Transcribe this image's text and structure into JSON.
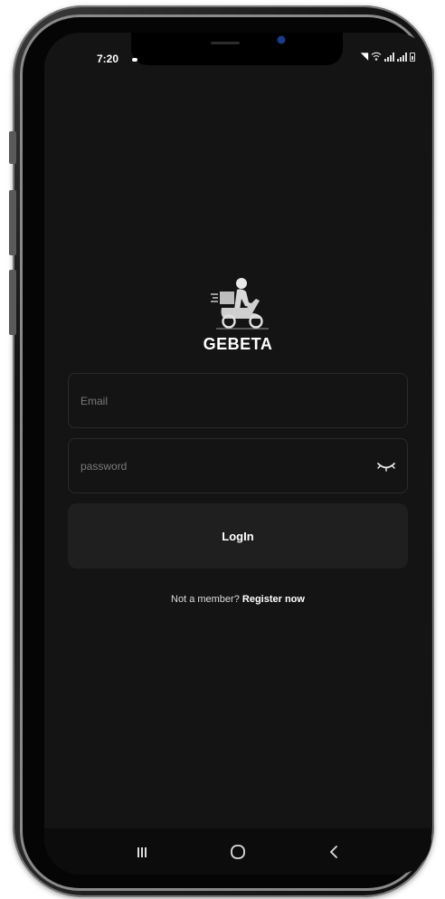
{
  "status_bar": {
    "time": "7:20",
    "icons": [
      "mute-icon",
      "wifi-icon",
      "signal-icon",
      "signal-icon",
      "battery-icon"
    ]
  },
  "logo": {
    "name": "GEBETA",
    "icon": "scooter-courier-logo-icon"
  },
  "login_form": {
    "email_placeholder": "Email",
    "email_value": "",
    "password_placeholder": "password",
    "password_value": "",
    "toggle_icon": "eye-closed-icon",
    "login_label": "LogIn"
  },
  "register": {
    "prompt": "Not a member?",
    "link": "Register now"
  },
  "nav_bar": {
    "icons": [
      "recent-apps-icon",
      "home-icon",
      "back-icon"
    ]
  },
  "colors": {
    "background": "#141414",
    "input_border": "#2a2a2a",
    "button": "#1f1f1f",
    "text": "#ffffff",
    "placeholder": "#7b7b7b"
  }
}
